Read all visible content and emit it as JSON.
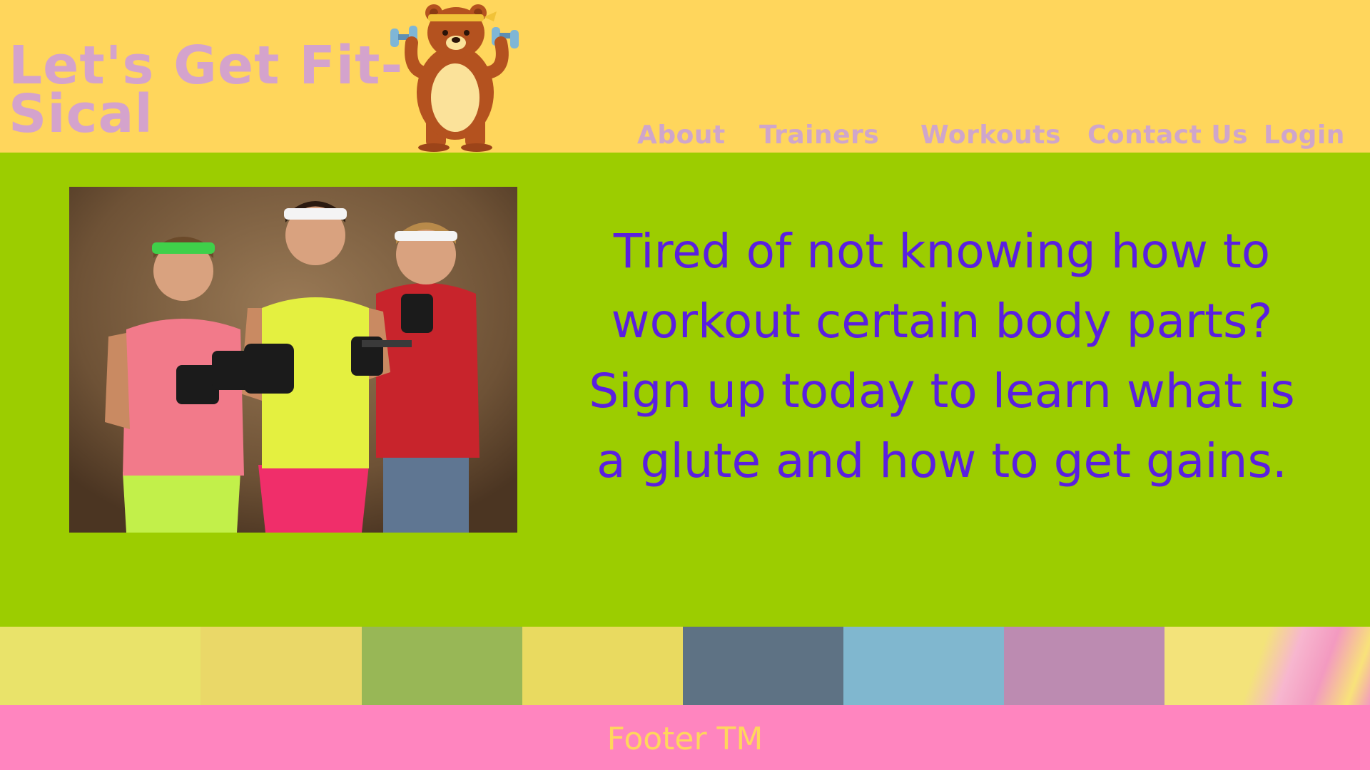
{
  "header": {
    "logo_line1": "Let's Get Fit-",
    "logo_line2": "Sical",
    "mascot_icon": "bear-with-dumbbells-icon",
    "nav": {
      "about": "About",
      "trainers": "Trainers",
      "workouts": "Workouts",
      "contact": "Contact Us",
      "login": "Login"
    }
  },
  "hero": {
    "photo": "three-men-with-dumbbells-photo",
    "tagline": "Tired of not knowing how to workout certain body parts? Sign up today to learn what is a glute and how to get gains."
  },
  "palette": [
    "#e9e36a",
    "#ead868",
    "#98b756",
    "#e9da60",
    "#5e7284",
    "#80b7cf",
    "#bc8bb1",
    "#f3e37a"
  ],
  "footer": {
    "text": "Footer TM"
  },
  "colors": {
    "header_bg": "#ffd65c",
    "logo": "#d4a3cc",
    "hero_bg": "#9ccd00",
    "tagline": "#5a1fe0",
    "footer_bg": "#ff85bf",
    "footer_text": "#ffd65c"
  }
}
